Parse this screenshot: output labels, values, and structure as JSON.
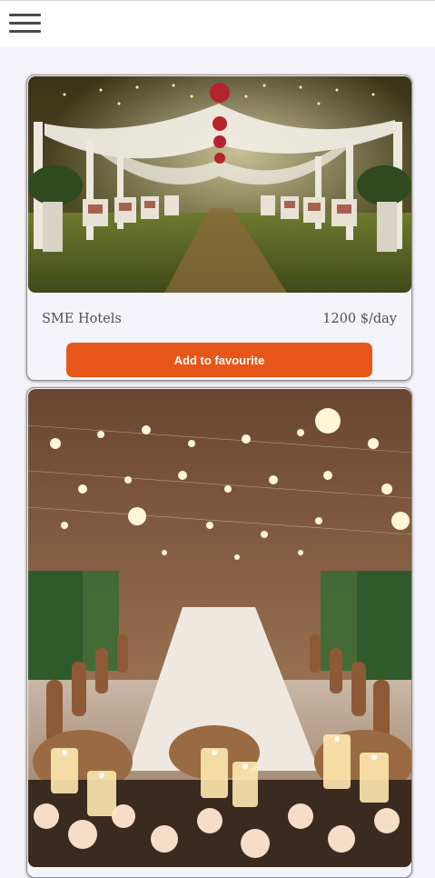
{
  "header": {
    "menu_icon": "hamburger-menu-icon"
  },
  "listings": [
    {
      "image": "outdoor-garden-wedding-venue-photo",
      "name": "SME Hotels",
      "price": "1200 $/day",
      "favourite_label": "Add to favourite"
    },
    {
      "image": "candlelit-banquet-table-under-lights-photo"
    }
  ],
  "colors": {
    "accent": "#e85519",
    "page_background": "#f3f2f8",
    "header_background": "#ffffff"
  }
}
